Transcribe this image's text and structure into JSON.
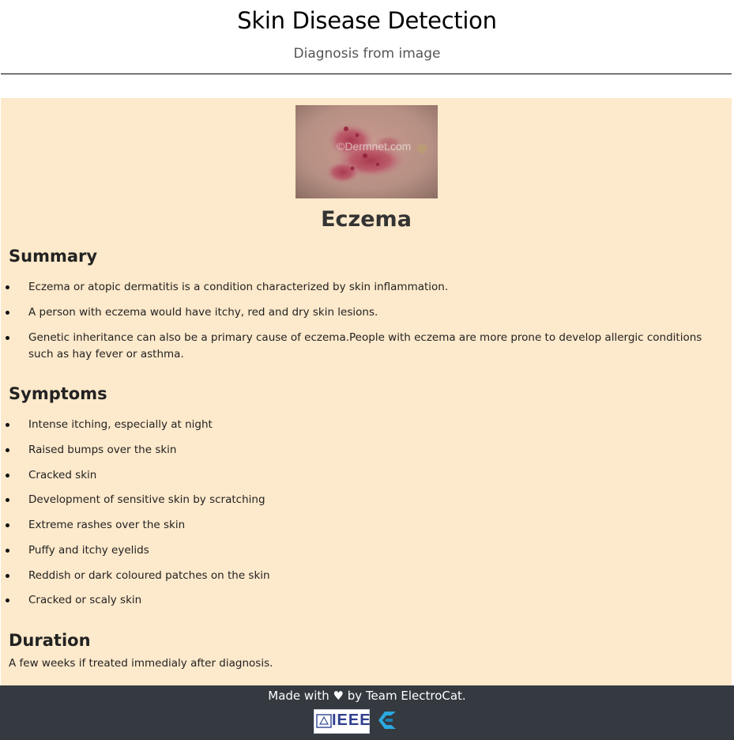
{
  "header": {
    "title": "Skin Disease Detection",
    "subtitle": "Diagnosis from image"
  },
  "result": {
    "image_watermark": "©Dermnet.com",
    "disease_name": "Eczema",
    "summary_heading": "Summary",
    "summary_items": [
      "Eczema or atopic dermatitis is a condition characterized by skin inflammation.",
      "A person with eczema would have itchy, red and dry skin lesions.",
      "Genetic inheritance can also be a primary cause of eczema.People with eczema are more prone to develop allergic conditions such as hay fever or asthma."
    ],
    "symptoms_heading": "Symptoms",
    "symptoms_items": [
      "Intense itching, especially at night",
      "Raised bumps over the skin",
      "Cracked skin",
      "Development of sensitive skin by scratching",
      "Extreme rashes over the skin",
      "Puffy and itchy eyelids",
      "Reddish or dark coloured patches on the skin",
      "Cracked or scaly skin"
    ],
    "duration_heading": "Duration",
    "duration_text": "A few weeks if treated immedialy after diagnosis."
  },
  "footer": {
    "made_with_prefix": "Made with",
    "heart": "♥",
    "made_with_suffix": "by Team ElectroCat.",
    "ieee_logo_text": "IEEE",
    "electrocat_logo_icon": "electrocat-logo-icon"
  },
  "colors": {
    "content_background": "#fde9cb",
    "footer_background": "#343a40"
  }
}
